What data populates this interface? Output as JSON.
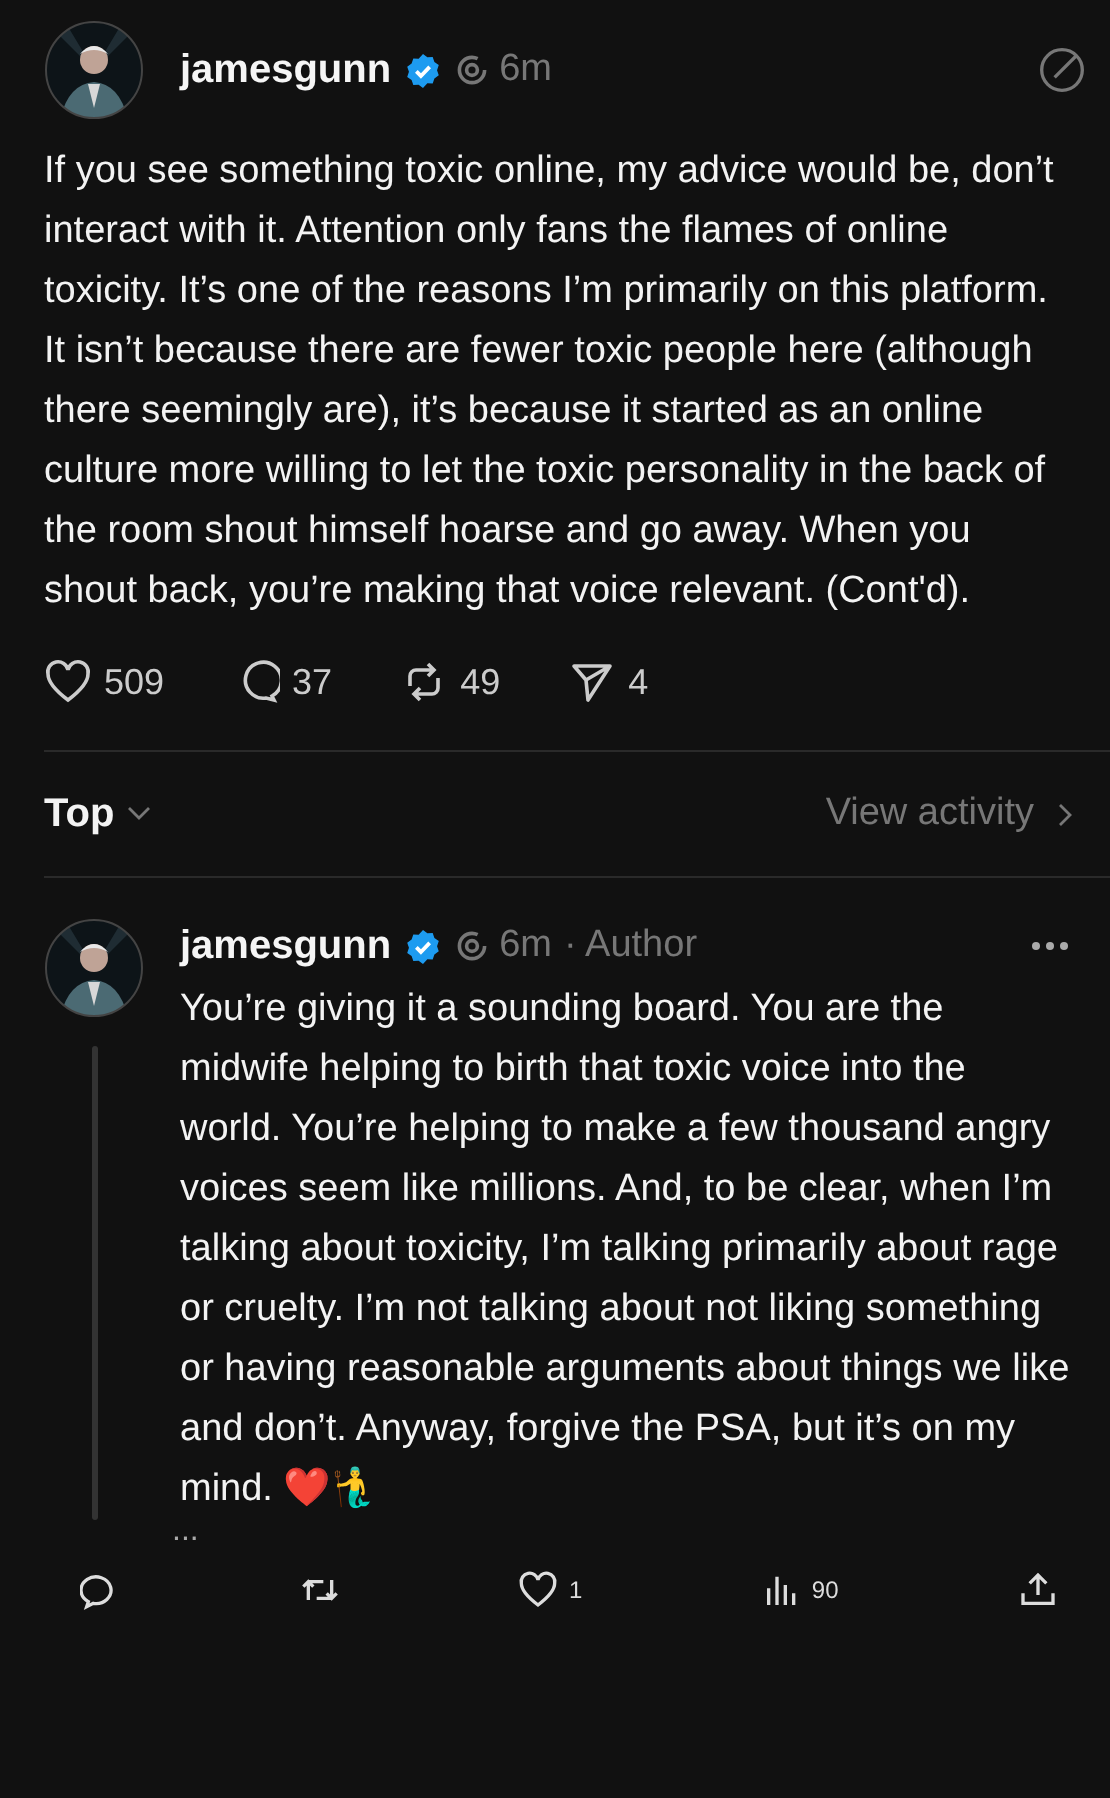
{
  "post": {
    "author": "jamesgunn",
    "verified": true,
    "time": "6m",
    "text": "If you see something toxic online, my advice would be, don’t interact with it. Attention only fans the flames of online toxicity. It’s one of the reasons I’m primarily on this platform. It isn’t because there are fewer toxic people here (although there seemingly are), it’s because it started as an online culture more willing to let the toxic personality in the back of the room shout himself hoarse and go away. When you shout back, you’re making that voice relevant. (Cont'd).",
    "actions": [
      {
        "kind": "like",
        "count": "509"
      },
      {
        "kind": "reply",
        "count": "37"
      },
      {
        "kind": "repost",
        "count": "49"
      },
      {
        "kind": "share",
        "count": "4"
      }
    ]
  },
  "sort": {
    "label": "Top",
    "activity": "View activity"
  },
  "reply": {
    "author": "jamesgunn",
    "verified": true,
    "time": "6m",
    "role": "· Author",
    "text": "You’re giving it a sounding board. You are the midwife helping to birth that toxic voice into the world. You’re helping to make a few thousand angry voices seem like millions. And, to be clear, when I’m talking about toxicity, I’m talking primarily about rage or cruelty. I’m not talking about not liking something or having reasonable arguments about things we like and don’t. Anyway, forgive the PSA, but it’s on my mind. ❤️🧜‍♂️",
    "more": "..."
  },
  "bottom_bar": [
    {
      "kind": "reply"
    },
    {
      "kind": "repost"
    },
    {
      "kind": "like",
      "count": "1"
    },
    {
      "kind": "views",
      "count": "90"
    },
    {
      "kind": "share"
    }
  ]
}
